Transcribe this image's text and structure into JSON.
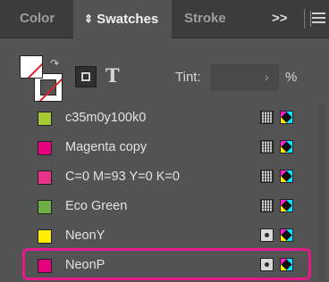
{
  "tabs": [
    {
      "label": "Color",
      "active": false
    },
    {
      "label": "Swatches",
      "active": true
    },
    {
      "label": "Stroke",
      "active": false
    }
  ],
  "overflow_label": ">>",
  "tint": {
    "label": "Tint:",
    "value": "",
    "unit": "%"
  },
  "text_toggle_label": "T",
  "swatches": [
    {
      "name": "c35m0y100k0",
      "color": "#a6c837",
      "mode": "process"
    },
    {
      "name": "Magenta copy",
      "color": "#e6007e",
      "mode": "process"
    },
    {
      "name": "C=0 M=93 Y=0 K=0",
      "color": "#e8338a",
      "mode": "process"
    },
    {
      "name": "Eco Green",
      "color": "#6fae45",
      "mode": "process"
    },
    {
      "name": "NeonY",
      "color": "#ffee00",
      "mode": "spot"
    },
    {
      "name": "NeonP",
      "color": "#e6007e",
      "mode": "spot"
    }
  ],
  "highlight_color": "#e8198b"
}
